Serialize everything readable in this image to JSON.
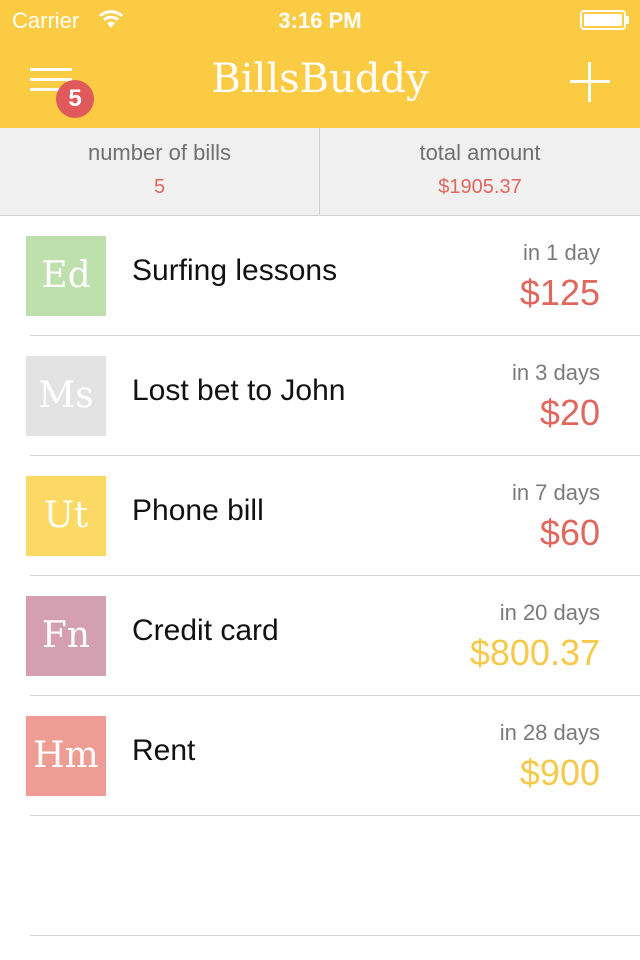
{
  "status_bar": {
    "carrier": "Carrier",
    "time": "3:16 PM",
    "wifi_icon": "wifi-icon",
    "battery_icon": "battery-icon"
  },
  "nav": {
    "title": "BillsBuddy",
    "menu_icon": "hamburger-menu-icon",
    "badge_count": "5",
    "add_icon": "plus-icon",
    "background_color": "#fbcb43",
    "badge_color": "#e0595b"
  },
  "summary": {
    "count_label": "number of bills",
    "count_value": "5",
    "total_label": "total amount",
    "total_value": "$1905.37",
    "value_color": "#e0675e"
  },
  "bills": [
    {
      "abbr": "Ed",
      "tile_color": "#bde0ad",
      "name": "Surfing lessons",
      "due": "in 1 day",
      "amount": "$125",
      "amount_color": "#e0675e"
    },
    {
      "abbr": "Ms",
      "tile_color": "#e3e3e3",
      "name": "Lost bet to John",
      "due": "in 3 days",
      "amount": "$20",
      "amount_color": "#e0675e"
    },
    {
      "abbr": "Ut",
      "tile_color": "#fcd964",
      "name": "Phone bill",
      "due": "in 7 days",
      "amount": "$60",
      "amount_color": "#e0675e"
    },
    {
      "abbr": "Fn",
      "tile_color": "#d4a0b1",
      "name": "Credit card",
      "due": "in 20 days",
      "amount": "$800.37",
      "amount_color": "#f7c94a"
    },
    {
      "abbr": "Hm",
      "tile_color": "#ed9d94",
      "name": "Rent",
      "due": "in 28 days",
      "amount": "$900",
      "amount_color": "#f7c94a"
    }
  ]
}
